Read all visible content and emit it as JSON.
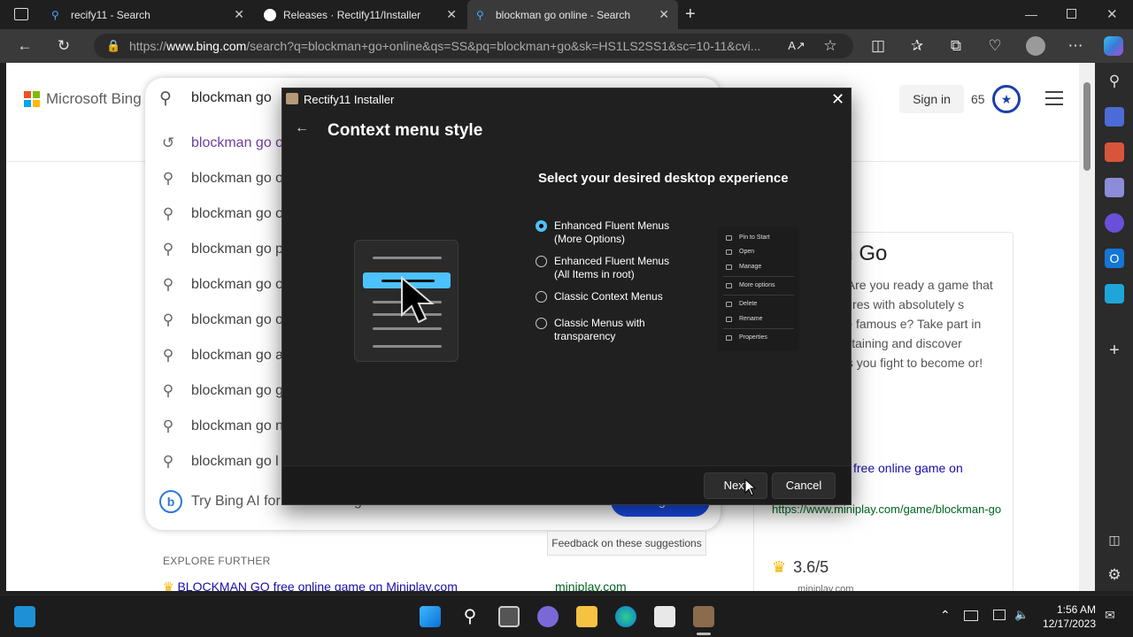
{
  "browser": {
    "tabs": [
      {
        "title": "recify11 - Search"
      },
      {
        "title": "Releases · Rectify11/Installer"
      },
      {
        "title": "blockman go online - Search"
      }
    ],
    "url_prefix": "https://",
    "url_domain": "www.bing.com",
    "url_rest": "/search?q=blockman+go+online&qs=SS&pq=blockman+go&sk=HS1LS2SS1&sc=10-11&cvi..."
  },
  "bing": {
    "logo_text": "Microsoft Bing",
    "search_value": "blockman go",
    "signin_label": "Sign in",
    "rewards_points": "65",
    "suggestions": [
      {
        "text": "blockman go o",
        "icon": "history-icon"
      },
      {
        "text": "blockman go o",
        "icon": "search-icon"
      },
      {
        "text": "blockman go o",
        "icon": "search-icon"
      },
      {
        "text": "blockman go p",
        "icon": "search-icon"
      },
      {
        "text": "blockman go o",
        "icon": "search-icon"
      },
      {
        "text": "blockman go o",
        "icon": "search-icon"
      },
      {
        "text": "blockman go a",
        "icon": "search-icon"
      },
      {
        "text": "blockman go g",
        "icon": "search-icon"
      },
      {
        "text": "blockman go n",
        "icon": "search-icon"
      },
      {
        "text": "blockman go l",
        "icon": "search-icon"
      }
    ],
    "try_bing_ai": "Try Bing AI for \"blockman go\"",
    "bing_ai_button": "Bing AI",
    "feedback": "Feedback on these suggestions",
    "explore_header": "EXPLORE FURTHER",
    "explore_link": "BLOCKMAN GO free online game on Miniplay.com",
    "explore_source": "miniplay.com",
    "card": {
      "title": "an Go",
      "description": "lockman GO! Are you ready a game that combines eatures with absolutely s inspired by the famous e? Take part in small joy entertaining and discover numerous s as you fight to become or!",
      "link": "free online game on",
      "url": "https://www.miniplay.com/game/blockman-go",
      "rating": "3.6/5",
      "rating_source": "miniplay.com"
    }
  },
  "installer": {
    "window_title": "Rectify11 Installer",
    "heading": "Context menu style",
    "subheading": "Select your desired desktop experience",
    "options": [
      {
        "line1": "Enhanced Fluent Menus",
        "line2": "(More Options)",
        "selected": true
      },
      {
        "line1": "Enhanced Fluent Menus",
        "line2": "(All Items in root)",
        "selected": false
      },
      {
        "line1": "Classic Context Menus",
        "line2": "",
        "selected": false
      },
      {
        "line1": "Classic Menus with",
        "line2": "transparency",
        "selected": false
      }
    ],
    "preview_items": [
      "Pin to Start",
      "Open",
      "Manage",
      "More options",
      "Delete",
      "Rename",
      "Properties"
    ],
    "next_label": "Next",
    "cancel_label": "Cancel",
    "accent_color": "#4cc2ff"
  },
  "taskbar": {
    "time": "1:56 AM",
    "date": "12/17/2023"
  }
}
